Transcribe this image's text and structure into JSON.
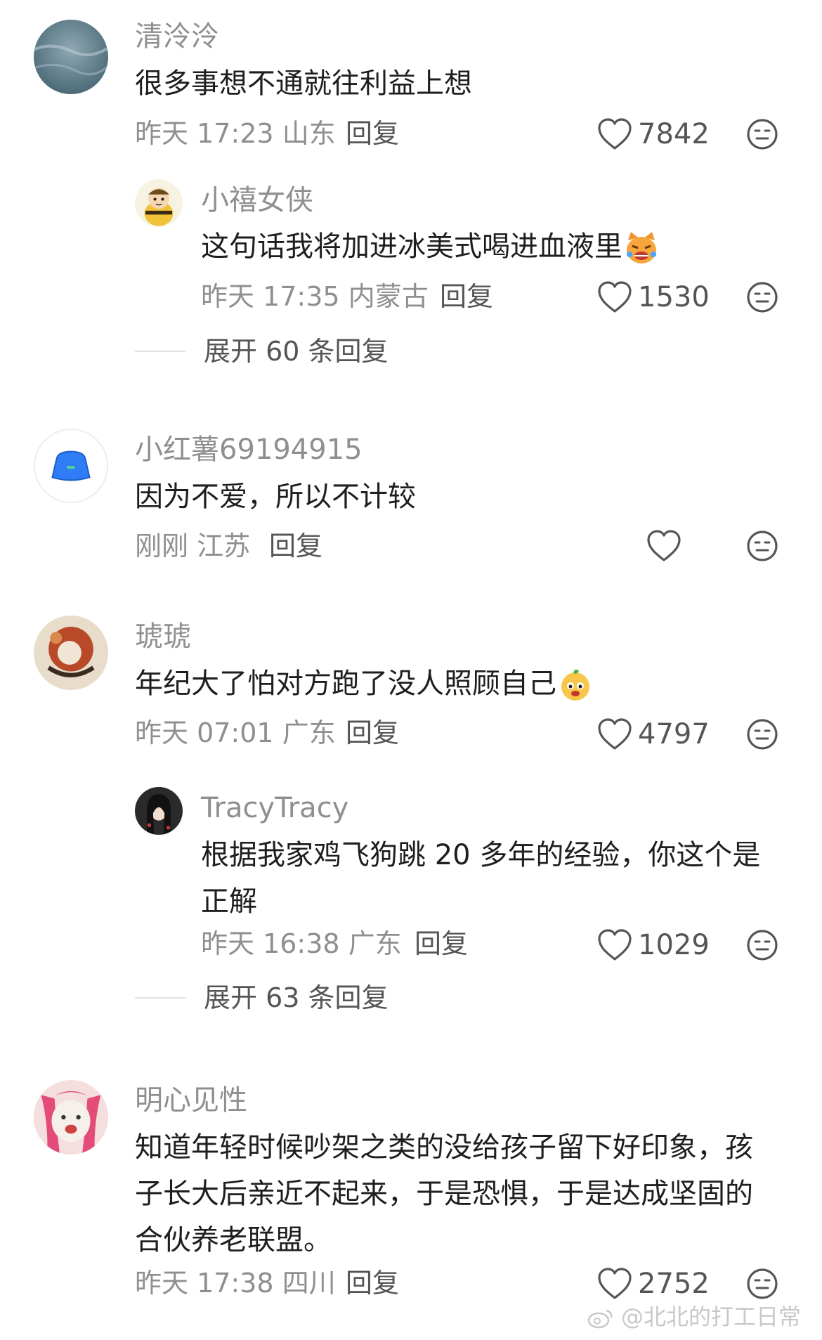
{
  "comments": [
    {
      "username": "清泠泠",
      "text": "很多事想不通就往利益上想",
      "time": "昨天 17:23",
      "location": "山东",
      "reply_label": "回复",
      "likes": "7842",
      "replies": [
        {
          "username": "小禧女侠",
          "text": "这句话我将加进冰美式喝进血液里",
          "time": "昨天 17:35",
          "location": "内蒙古",
          "reply_label": "回复",
          "likes": "1530"
        }
      ],
      "expand_label": "展开 60 条回复"
    },
    {
      "username": "小红薯69194915",
      "text": "因为不爱，所以不计较",
      "time": "刚刚",
      "location": "江苏",
      "reply_label": "回复",
      "likes": ""
    },
    {
      "username": "琥琥",
      "text": "年纪大了怕对方跑了没人照顾自己",
      "time": "昨天 07:01",
      "location": "广东",
      "reply_label": "回复",
      "likes": "4797",
      "replies": [
        {
          "username": "TracyTracy",
          "text_line1": "根据我家鸡飞狗跳 20 多年的经验，你这个是",
          "text_line2": "正解",
          "time": "昨天 16:38",
          "location": "广东",
          "reply_label": "回复",
          "likes": "1029"
        }
      ],
      "expand_label": "展开 63 条回复"
    },
    {
      "username": "明心见性",
      "text_line1": "知道年轻时候吵架之类的没给孩子留下好印象，孩",
      "text_line2": "子长大后亲近不起来，于是恐惧，于是达成坚固的",
      "text_line3": "合伙养老联盟。",
      "time": "昨天 17:38",
      "location": "四川",
      "reply_label": "回复",
      "likes": "2752"
    }
  ],
  "watermark": "@北北的打工日常",
  "icons": {
    "like": "heart-outline-icon",
    "dislike": "neutral-face-icon",
    "weibo": "weibo-logo-icon"
  },
  "colors": {
    "username": "#8f8f8f",
    "text": "#1e1e1e",
    "meta": "#8f8f8f",
    "action": "#555555"
  }
}
